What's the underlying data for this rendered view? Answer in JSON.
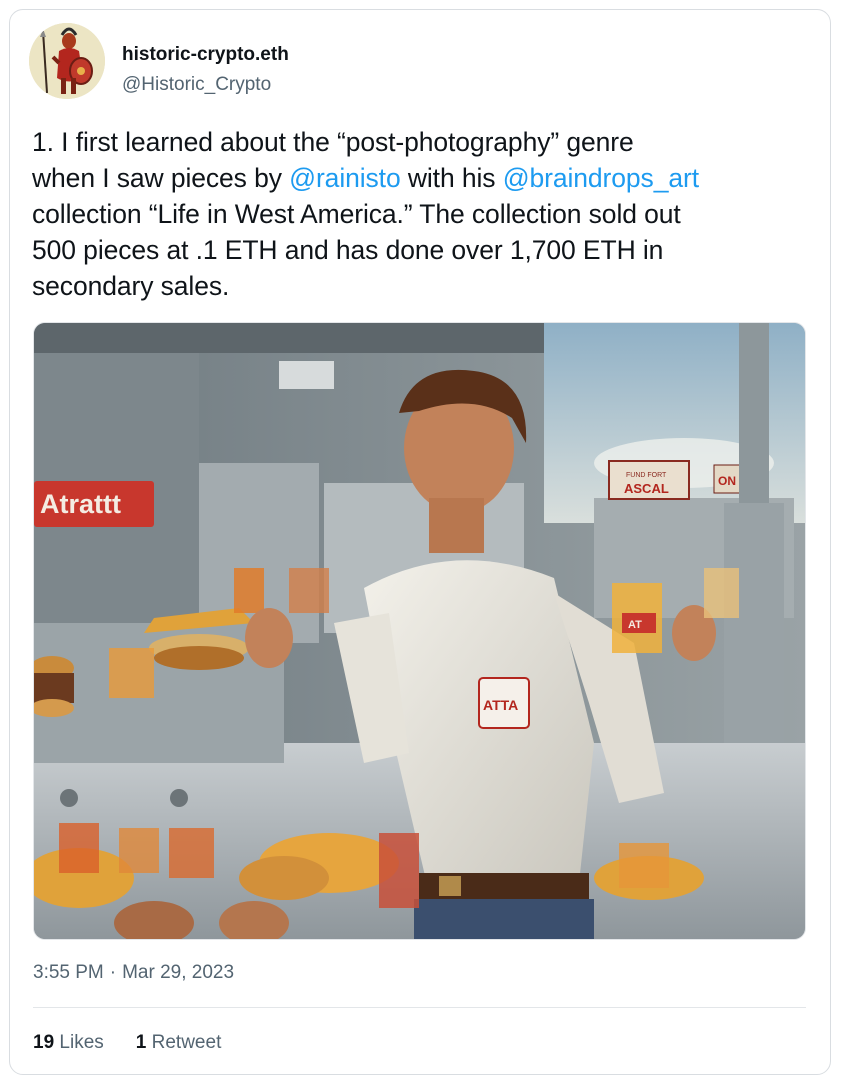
{
  "user": {
    "display_name": "historic-crypto.eth",
    "handle": "@Historic_Crypto",
    "avatar_icon": "avatar-warrior-illustration"
  },
  "tweet": {
    "lines": [
      {
        "parts": [
          {
            "text": "1. I first learned about the “post-photography” genre",
            "mention": false
          }
        ]
      },
      {
        "parts": [
          {
            "text": "when I saw pieces by ",
            "mention": false
          },
          {
            "text": "@rainisto",
            "mention": true
          },
          {
            "text": " with his ",
            "mention": false
          },
          {
            "text": "@braindrops_art",
            "mention": true
          }
        ]
      },
      {
        "parts": [
          {
            "text": "collection “Life in West America.” The collection sold out",
            "mention": false
          }
        ]
      },
      {
        "parts": [
          {
            "text": "500 pieces at .1 ETH and has done over 1,700 ETH in",
            "mention": false
          }
        ]
      },
      {
        "parts": [
          {
            "text": "secondary sales.",
            "mention": false
          }
        ]
      }
    ],
    "mention_color": "#1d9bf0"
  },
  "media": {
    "sign_text": "Atrattt",
    "shirt_logo_text": "ATTA",
    "cup_label_text": "AT",
    "background_sign_text": "ASCAL",
    "background_sign_small_text": "FUND FORT",
    "can_label_text": "ON"
  },
  "meta": {
    "time": "3:55 PM",
    "separator": "·",
    "date": "Mar 29, 2023"
  },
  "stats": {
    "likes_count": "19",
    "likes_label": "Likes",
    "retweets_count": "1",
    "retweets_label": "Retweet"
  }
}
